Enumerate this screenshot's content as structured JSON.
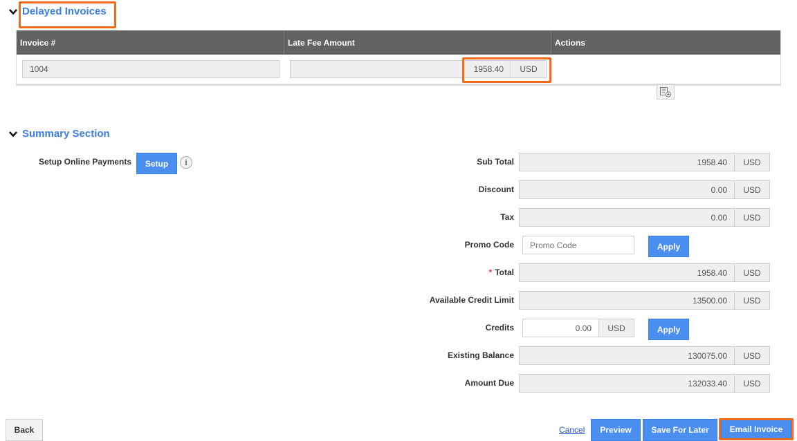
{
  "delayed_invoices": {
    "title": "Delayed Invoices",
    "columns": [
      "Invoice #",
      "Late Fee Amount",
      "Actions"
    ],
    "rows": [
      {
        "invoice_number": "1004",
        "late_fee_amount": "1958.40",
        "currency": "USD",
        "action_icon": "add-note-icon"
      }
    ]
  },
  "summary": {
    "title": "Summary Section",
    "online_payments": {
      "label": "Setup Online Payments",
      "button": "Setup",
      "info_icon": "info-icon"
    },
    "fields": {
      "sub_total": {
        "label": "Sub Total",
        "value": "1958.40",
        "currency": "USD"
      },
      "discount": {
        "label": "Discount",
        "value": "0.00",
        "currency": "USD"
      },
      "tax": {
        "label": "Tax",
        "value": "0.00",
        "currency": "USD"
      },
      "promo_code": {
        "label": "Promo Code",
        "value": "",
        "placeholder": "Promo Code",
        "button": "Apply"
      },
      "total": {
        "label": "Total",
        "required_marker": "*",
        "value": "1958.40",
        "currency": "USD"
      },
      "available_credit_limit": {
        "label": "Available Credit Limit",
        "value": "13500.00",
        "currency": "USD"
      },
      "credits": {
        "label": "Credits",
        "value": "0.00",
        "currency": "USD",
        "button": "Apply"
      },
      "existing_balance": {
        "label": "Existing Balance",
        "value": "130075.00",
        "currency": "USD"
      },
      "amount_due": {
        "label": "Amount Due",
        "value": "132033.40",
        "currency": "USD"
      }
    }
  },
  "footer": {
    "back": "Back",
    "cancel": "Cancel",
    "preview": "Preview",
    "save_for_later": "Save For Later",
    "email_invoice": "Email Invoice"
  },
  "colors": {
    "accent": "#3b7de0",
    "button_blue": "#4a8ef0",
    "highlight": "#f26b1d",
    "table_header": "#626262"
  }
}
